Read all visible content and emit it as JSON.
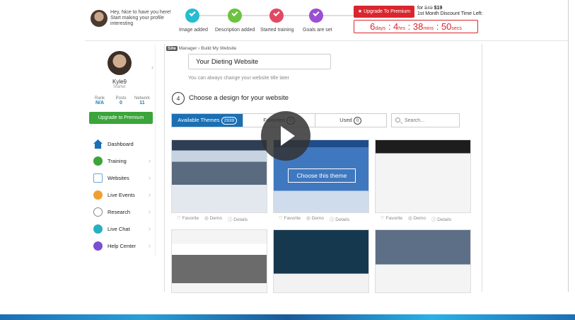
{
  "greeting": {
    "line1": "Hey, Nice to have you here!",
    "line2": "Start making your profile",
    "line3": "interesting"
  },
  "steps": [
    {
      "label": "Image added",
      "color": "#27bcd0"
    },
    {
      "label": "Description added",
      "color": "#6dc23f"
    },
    {
      "label": "Started training",
      "color": "#e04a63"
    },
    {
      "label": "Goals are set",
      "color": "#9b4fd1"
    }
  ],
  "promo": {
    "button": "★ Upgrade To Premium",
    "old_price": "$49",
    "new_price": "$19",
    "for_label": "for",
    "subtitle": "1st Month Discount Time Left:",
    "timer": {
      "days": "6",
      "hrs": "4",
      "mins": "38",
      "secs": "50",
      "days_label": "days",
      "hrs_label": "hrs",
      "mins_label": "mins",
      "secs_label": "secs"
    }
  },
  "profile": {
    "name": "Kyle9",
    "level": "Starter",
    "stats": [
      {
        "label": "Rank",
        "value": "N/A"
      },
      {
        "label": "Posts",
        "value": "0"
      },
      {
        "label": "Network",
        "value": "11"
      }
    ],
    "upgrade": "Upgrade to Premium"
  },
  "nav": [
    {
      "label": "Dashboard",
      "icon": "home-icon",
      "color": "#1a6fb5"
    },
    {
      "label": "Training",
      "icon": "play-circle-icon",
      "color": "#3aa53a"
    },
    {
      "label": "Websites",
      "icon": "wordpress-icon",
      "color": "#6aa7d8"
    },
    {
      "label": "Live Events",
      "icon": "events-icon",
      "color": "#f0a030"
    },
    {
      "label": "Research",
      "icon": "research-icon",
      "color": "#888888"
    },
    {
      "label": "Live Chat",
      "icon": "chat-icon",
      "color": "#27b0c0"
    },
    {
      "label": "Help Center",
      "icon": "help-icon",
      "color": "#7b4fd1"
    }
  ],
  "breadcrumb": {
    "logo": "Site",
    "section": "Manager",
    "page": "Build My Website"
  },
  "website_title": "Your Dieting Website",
  "title_hint": "You can always change your website title later",
  "step4": {
    "number": "4",
    "title": "Choose a design for your website"
  },
  "tabs": [
    {
      "label": "Available Themes",
      "count": "2939"
    },
    {
      "label": "Favorites",
      "count": "0"
    },
    {
      "label": "Used",
      "count": "0"
    }
  ],
  "search_placeholder": "Search...",
  "card_actions": {
    "favorite": "Favorite",
    "demo": "Demo",
    "details": "Details"
  },
  "choose_theme": "Choose this theme"
}
